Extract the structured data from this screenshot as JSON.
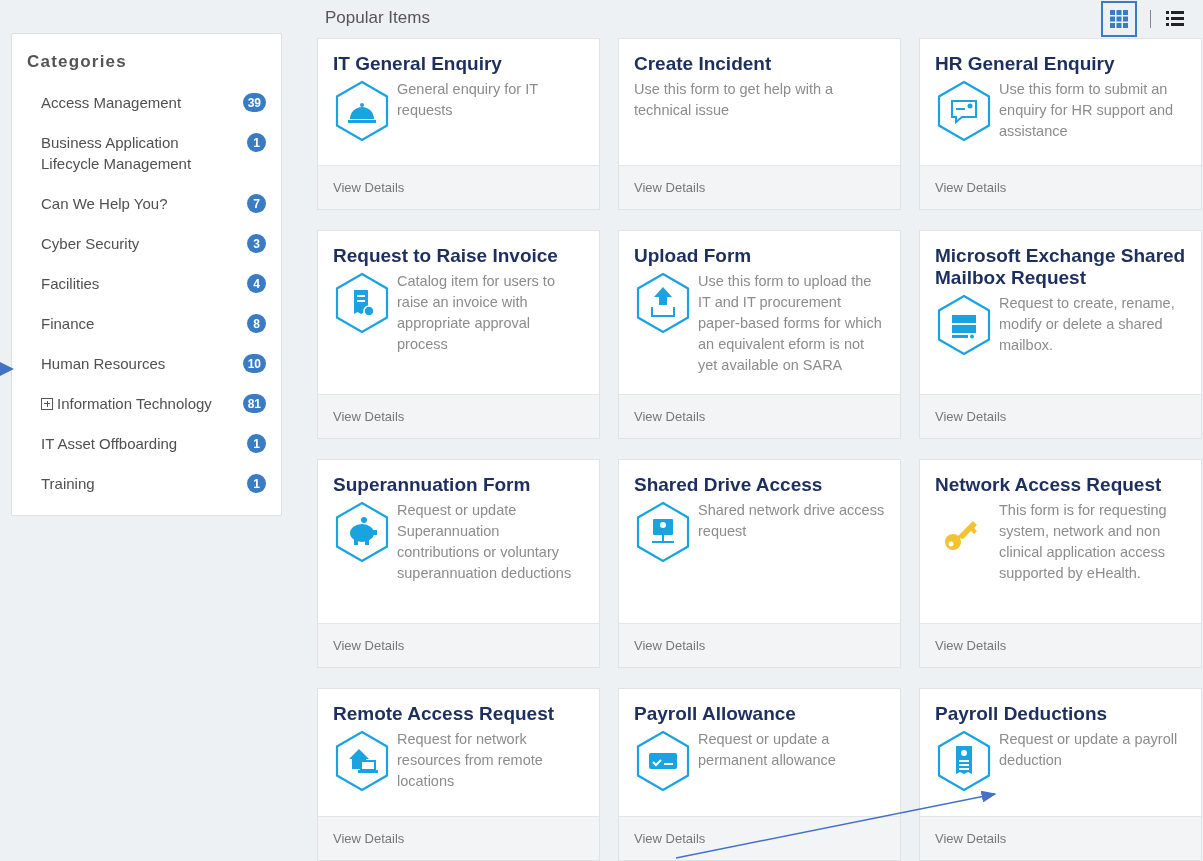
{
  "sidebar": {
    "title": "Categories",
    "items": [
      {
        "label": "Access Management",
        "count": "39"
      },
      {
        "label": "Business Application Lifecycle Management",
        "count": "1"
      },
      {
        "label": "Can We Help You?",
        "count": "7"
      },
      {
        "label": "Cyber Security",
        "count": "3"
      },
      {
        "label": "Facilities",
        "count": "4"
      },
      {
        "label": "Finance",
        "count": "8"
      },
      {
        "label": "Human Resources",
        "count": "10"
      },
      {
        "label": "Information Technology",
        "count": "81",
        "expanded": false
      },
      {
        "label": "IT Asset Offboarding",
        "count": "1"
      },
      {
        "label": "Training",
        "count": "1"
      }
    ]
  },
  "main": {
    "title": "Popular Items",
    "view_toggle": [
      {
        "kind": "grid",
        "selected": true
      },
      {
        "kind": "list",
        "selected": false
      }
    ],
    "cards": [
      {
        "title": "IT General Enquiry",
        "description": "General enquiry for IT requests",
        "link": "View Details"
      },
      {
        "title": "Create Incident",
        "description": "Use this form to get help with a technical issue",
        "link": "View Details"
      },
      {
        "title": "HR General Enquiry",
        "description": "Use this form to submit an enquiry for HR support and assistance",
        "link": "View Details"
      },
      {
        "title": "Request to Raise Invoice",
        "description": "Catalog item for users to raise an invoice with appropriate approval process",
        "link": "View Details"
      },
      {
        "title": "Upload Form",
        "description": "Use this form to upload the IT and IT procurement paper-based forms for which an equivalent eform is not yet available on SARA",
        "link": "View Details"
      },
      {
        "title": "Microsoft Exchange Shared Mailbox Request",
        "description": "Request to create, rename, modify or delete a shared mailbox.",
        "link": "View Details"
      },
      {
        "title": "Superannuation Form",
        "description": "Request or update Superannuation contributions or voluntary superannuation deductions",
        "link": "View Details"
      },
      {
        "title": "Shared Drive Access",
        "description": "Shared network drive access request",
        "link": "View Details"
      },
      {
        "title": "Network Access Request",
        "description": "This form is for requesting system, network and non clinical application access supported by eHealth.",
        "link": "View Details"
      },
      {
        "title": "Remote Access Request",
        "description": "Request for network resources from remote locations",
        "link": "View Details"
      },
      {
        "title": "Payroll Allowance",
        "description": "Request or update a permanent allowance",
        "link": "View Details"
      },
      {
        "title": "Payroll Deductions",
        "description": "Request or update a payroll deduction",
        "link": "View Details"
      }
    ]
  }
}
